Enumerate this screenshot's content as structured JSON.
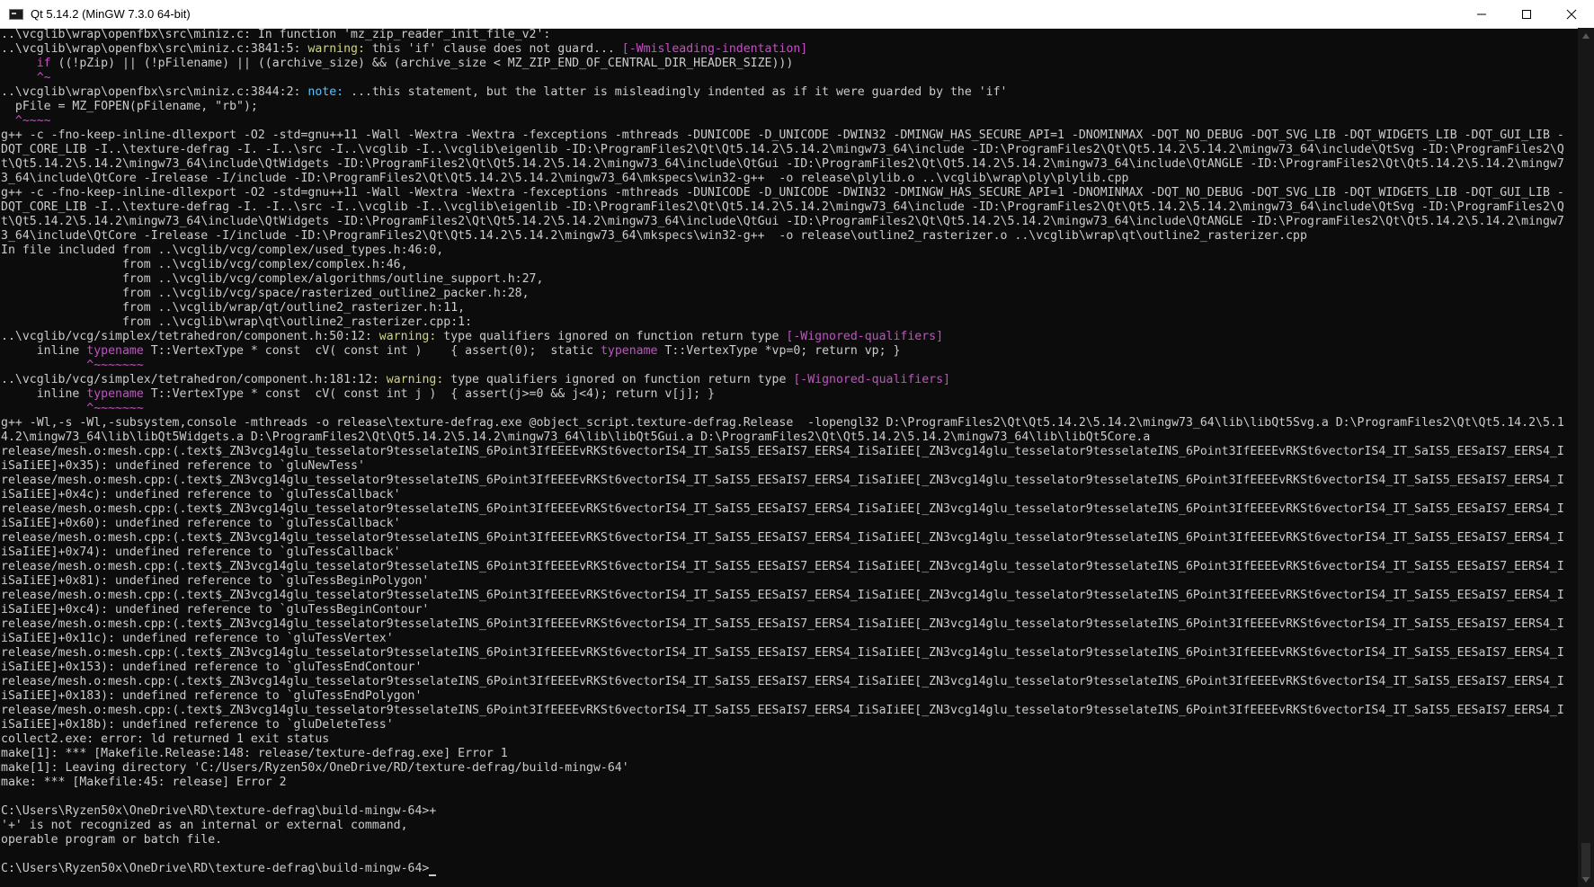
{
  "window": {
    "title": "Qt 5.14.2 (MinGW 7.3.0 64-bit)",
    "icon": "console-icon"
  },
  "controls": {
    "minimize": "minimize-icon",
    "maximize": "maximize-icon",
    "close": "close-icon"
  },
  "terminal": {
    "lines": [
      {
        "t": "..\\vcglib\\wrap\\openfbx\\src\\miniz.c: In function 'mz_zip_reader_init_file_v2':"
      },
      {
        "t": "..\\vcglib\\wrap\\openfbx\\src\\miniz.c:3841:5: warning: this 'if' clause does not guard... [-Wmisleading-indentation]"
      },
      {
        "t": "     if ((!pZip) || (!pFilename) || ((archive_size) && (archive_size < MZ_ZIP_END_OF_CENTRAL_DIR_HEADER_SIZE)))"
      },
      {
        "t": "     ^~"
      },
      {
        "t": "..\\vcglib\\wrap\\openfbx\\src\\miniz.c:3844:2: note: ...this statement, but the latter is misleadingly indented as if it were guarded by the 'if'"
      },
      {
        "t": "  pFile = MZ_FOPEN(pFilename, \"rb\");"
      },
      {
        "t": "  ^~~~~"
      },
      {
        "t": "g++ -c -fno-keep-inline-dllexport -O2 -std=gnu++11 -Wall -Wextra -Wextra -fexceptions -mthreads -DUNICODE -D_UNICODE -DWIN32 -DMINGW_HAS_SECURE_API=1 -DNOMINMAX -DQT_NO_DEBUG -DQT_SVG_LIB -DQT_WIDGETS_LIB -DQT_GUI_LIB -"
      },
      {
        "t": "DQT_CORE_LIB -I..\\texture-defrag -I. -I..\\src -I..\\vcglib -I..\\vcglib\\eigenlib -ID:\\ProgramFiles2\\Qt\\Qt5.14.2\\5.14.2\\mingw73_64\\include -ID:\\ProgramFiles2\\Qt\\Qt5.14.2\\5.14.2\\mingw73_64\\include\\QtSvg -ID:\\ProgramFiles2\\Q"
      },
      {
        "t": "t\\Qt5.14.2\\5.14.2\\mingw73_64\\include\\QtWidgets -ID:\\ProgramFiles2\\Qt\\Qt5.14.2\\5.14.2\\mingw73_64\\include\\QtGui -ID:\\ProgramFiles2\\Qt\\Qt5.14.2\\5.14.2\\mingw73_64\\include\\QtANGLE -ID:\\ProgramFiles2\\Qt\\Qt5.14.2\\5.14.2\\mingw7"
      },
      {
        "t": "3_64\\include\\QtCore -Irelease -I/include -ID:\\ProgramFiles2\\Qt\\Qt5.14.2\\5.14.2\\mingw73_64\\mkspecs\\win32-g++  -o release\\plylib.o ..\\vcglib\\wrap\\ply\\plylib.cpp"
      },
      {
        "t": "g++ -c -fno-keep-inline-dllexport -O2 -std=gnu++11 -Wall -Wextra -Wextra -fexceptions -mthreads -DUNICODE -D_UNICODE -DWIN32 -DMINGW_HAS_SECURE_API=1 -DNOMINMAX -DQT_NO_DEBUG -DQT_SVG_LIB -DQT_WIDGETS_LIB -DQT_GUI_LIB -"
      },
      {
        "t": "DQT_CORE_LIB -I..\\texture-defrag -I. -I..\\src -I..\\vcglib -I..\\vcglib\\eigenlib -ID:\\ProgramFiles2\\Qt\\Qt5.14.2\\5.14.2\\mingw73_64\\include -ID:\\ProgramFiles2\\Qt\\Qt5.14.2\\5.14.2\\mingw73_64\\include\\QtSvg -ID:\\ProgramFiles2\\Q"
      },
      {
        "t": "t\\Qt5.14.2\\5.14.2\\mingw73_64\\include\\QtWidgets -ID:\\ProgramFiles2\\Qt\\Qt5.14.2\\5.14.2\\mingw73_64\\include\\QtGui -ID:\\ProgramFiles2\\Qt\\Qt5.14.2\\5.14.2\\mingw73_64\\include\\QtANGLE -ID:\\ProgramFiles2\\Qt\\Qt5.14.2\\5.14.2\\mingw7"
      },
      {
        "t": "3_64\\include\\QtCore -Irelease -I/include -ID:\\ProgramFiles2\\Qt\\Qt5.14.2\\5.14.2\\mingw73_64\\mkspecs\\win32-g++  -o release\\outline2_rasterizer.o ..\\vcglib\\wrap\\qt\\outline2_rasterizer.cpp"
      },
      {
        "t": "In file included from ..\\vcglib/vcg/complex/used_types.h:46:0,"
      },
      {
        "t": "                 from ..\\vcglib/vcg/complex/complex.h:46,"
      },
      {
        "t": "                 from ..\\vcglib/vcg/complex/algorithms/outline_support.h:27,"
      },
      {
        "t": "                 from ..\\vcglib/vcg/space/rasterized_outline2_packer.h:28,"
      },
      {
        "t": "                 from ..\\vcglib/wrap/qt/outline2_rasterizer.h:11,"
      },
      {
        "t": "                 from ..\\vcglib\\wrap\\qt\\outline2_rasterizer.cpp:1:"
      },
      {
        "t": "..\\vcglib/vcg/simplex/tetrahedron/component.h:50:12: warning: type qualifiers ignored on function return type [-Wignored-qualifiers]"
      },
      {
        "t": "     inline typename T::VertexType * const  cV( const int )    { assert(0);  static typename T::VertexType *vp=0; return vp; }"
      },
      {
        "t": "            ^~~~~~~~"
      },
      {
        "t": "..\\vcglib/vcg/simplex/tetrahedron/component.h:181:12: warning: type qualifiers ignored on function return type [-Wignored-qualifiers]"
      },
      {
        "t": "     inline typename T::VertexType * const  cV( const int j )  { assert(j>=0 && j<4); return v[j]; }"
      },
      {
        "t": "            ^~~~~~~~"
      },
      {
        "t": "g++ -Wl,-s -Wl,-subsystem,console -mthreads -o release\\texture-defrag.exe @object_script.texture-defrag.Release  -lopengl32 D:\\ProgramFiles2\\Qt\\Qt5.14.2\\5.14.2\\mingw73_64\\lib\\libQt5Svg.a D:\\ProgramFiles2\\Qt\\Qt5.14.2\\5.1"
      },
      {
        "t": "4.2\\mingw73_64\\lib\\libQt5Widgets.a D:\\ProgramFiles2\\Qt\\Qt5.14.2\\5.14.2\\mingw73_64\\lib\\libQt5Gui.a D:\\ProgramFiles2\\Qt\\Qt5.14.2\\5.14.2\\mingw73_64\\lib\\libQt5Core.a"
      },
      {
        "t": "release/mesh.o:mesh.cpp:(.text$_ZN3vcg14glu_tesselator9tesselateINS_6Point3IfEEEEvRKSt6vectorIS4_IT_SaIS5_EESaIS7_EERS4_IiSaIiEE[_ZN3vcg14glu_tesselator9tesselateINS_6Point3IfEEEEvRKSt6vectorIS4_IT_SaIS5_EESaIS7_EERS4_I"
      },
      {
        "t": "iSaIiEE]+0x35): undefined reference to `gluNewTess'"
      },
      {
        "t": "release/mesh.o:mesh.cpp:(.text$_ZN3vcg14glu_tesselator9tesselateINS_6Point3IfEEEEvRKSt6vectorIS4_IT_SaIS5_EESaIS7_EERS4_IiSaIiEE[_ZN3vcg14glu_tesselator9tesselateINS_6Point3IfEEEEvRKSt6vectorIS4_IT_SaIS5_EESaIS7_EERS4_I"
      },
      {
        "t": "iSaIiEE]+0x4c): undefined reference to `gluTessCallback'"
      },
      {
        "t": "release/mesh.o:mesh.cpp:(.text$_ZN3vcg14glu_tesselator9tesselateINS_6Point3IfEEEEvRKSt6vectorIS4_IT_SaIS5_EESaIS7_EERS4_IiSaIiEE[_ZN3vcg14glu_tesselator9tesselateINS_6Point3IfEEEEvRKSt6vectorIS4_IT_SaIS5_EESaIS7_EERS4_I"
      },
      {
        "t": "iSaIiEE]+0x60): undefined reference to `gluTessCallback'"
      },
      {
        "t": "release/mesh.o:mesh.cpp:(.text$_ZN3vcg14glu_tesselator9tesselateINS_6Point3IfEEEEvRKSt6vectorIS4_IT_SaIS5_EESaIS7_EERS4_IiSaIiEE[_ZN3vcg14glu_tesselator9tesselateINS_6Point3IfEEEEvRKSt6vectorIS4_IT_SaIS5_EESaIS7_EERS4_I"
      },
      {
        "t": "iSaIiEE]+0x74): undefined reference to `gluTessCallback'"
      },
      {
        "t": "release/mesh.o:mesh.cpp:(.text$_ZN3vcg14glu_tesselator9tesselateINS_6Point3IfEEEEvRKSt6vectorIS4_IT_SaIS5_EESaIS7_EERS4_IiSaIiEE[_ZN3vcg14glu_tesselator9tesselateINS_6Point3IfEEEEvRKSt6vectorIS4_IT_SaIS5_EESaIS7_EERS4_I"
      },
      {
        "t": "iSaIiEE]+0x81): undefined reference to `gluTessBeginPolygon'"
      },
      {
        "t": "release/mesh.o:mesh.cpp:(.text$_ZN3vcg14glu_tesselator9tesselateINS_6Point3IfEEEEvRKSt6vectorIS4_IT_SaIS5_EESaIS7_EERS4_IiSaIiEE[_ZN3vcg14glu_tesselator9tesselateINS_6Point3IfEEEEvRKSt6vectorIS4_IT_SaIS5_EESaIS7_EERS4_I"
      },
      {
        "t": "iSaIiEE]+0xc4): undefined reference to `gluTessBeginContour'"
      },
      {
        "t": "release/mesh.o:mesh.cpp:(.text$_ZN3vcg14glu_tesselator9tesselateINS_6Point3IfEEEEvRKSt6vectorIS4_IT_SaIS5_EESaIS7_EERS4_IiSaIiEE[_ZN3vcg14glu_tesselator9tesselateINS_6Point3IfEEEEvRKSt6vectorIS4_IT_SaIS5_EESaIS7_EERS4_I"
      },
      {
        "t": "iSaIiEE]+0x11c): undefined reference to `gluTessVertex'"
      },
      {
        "t": "release/mesh.o:mesh.cpp:(.text$_ZN3vcg14glu_tesselator9tesselateINS_6Point3IfEEEEvRKSt6vectorIS4_IT_SaIS5_EESaIS7_EERS4_IiSaIiEE[_ZN3vcg14glu_tesselator9tesselateINS_6Point3IfEEEEvRKSt6vectorIS4_IT_SaIS5_EESaIS7_EERS4_I"
      },
      {
        "t": "iSaIiEE]+0x153): undefined reference to `gluTessEndContour'"
      },
      {
        "t": "release/mesh.o:mesh.cpp:(.text$_ZN3vcg14glu_tesselator9tesselateINS_6Point3IfEEEEvRKSt6vectorIS4_IT_SaIS5_EESaIS7_EERS4_IiSaIiEE[_ZN3vcg14glu_tesselator9tesselateINS_6Point3IfEEEEvRKSt6vectorIS4_IT_SaIS5_EESaIS7_EERS4_I"
      },
      {
        "t": "iSaIiEE]+0x183): undefined reference to `gluTessEndPolygon'"
      },
      {
        "t": "release/mesh.o:mesh.cpp:(.text$_ZN3vcg14glu_tesselator9tesselateINS_6Point3IfEEEEvRKSt6vectorIS4_IT_SaIS5_EESaIS7_EERS4_IiSaIiEE[_ZN3vcg14glu_tesselator9tesselateINS_6Point3IfEEEEvRKSt6vectorIS4_IT_SaIS5_EESaIS7_EERS4_I"
      },
      {
        "t": "iSaIiEE]+0x18b): undefined reference to `gluDeleteTess'"
      },
      {
        "t": "collect2.exe: error: ld returned 1 exit status"
      },
      {
        "t": "make[1]: *** [Makefile.Release:148: release/texture-defrag.exe] Error 1"
      },
      {
        "t": "make[1]: Leaving directory 'C:/Users/Ryzen50x/OneDrive/RD/texture-defrag/build-mingw-64'"
      },
      {
        "t": "make: *** [Makefile:45: release] Error 2"
      },
      {
        "t": ""
      },
      {
        "t": "C:\\Users\\Ryzen50x\\OneDrive\\RD\\texture-defrag\\build-mingw-64>+"
      },
      {
        "t": "'+' is not recognized as an internal or external command,"
      },
      {
        "t": "operable program or batch file."
      },
      {
        "t": ""
      },
      {
        "t": "C:\\Users\\Ryzen50x\\OneDrive\\RD\\texture-defrag\\build-mingw-64>"
      }
    ],
    "colors": {
      "background": "#0c0c0c",
      "text": "#cccccc",
      "warning": "#d4d47a",
      "note": "#52c7ff",
      "highlight": "#c550c5"
    }
  },
  "scrollbar": {
    "up": "scroll-up-arrow-icon",
    "down": "scroll-down-arrow-icon"
  }
}
